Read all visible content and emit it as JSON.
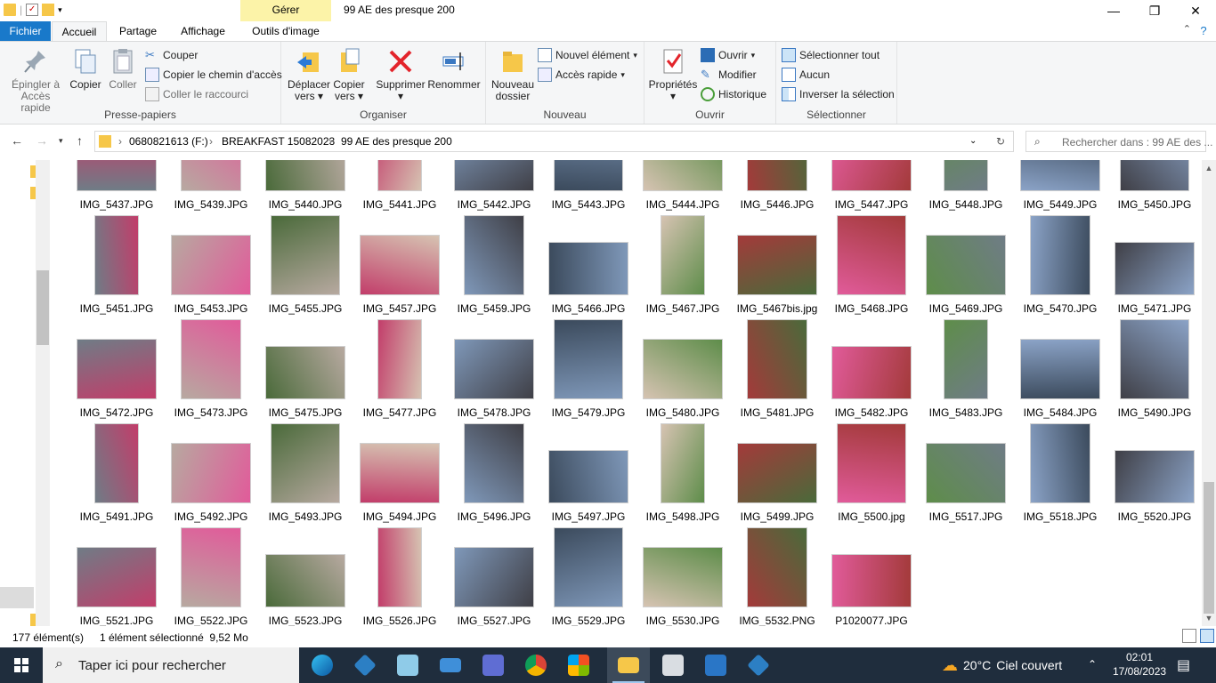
{
  "window": {
    "title": "99 AE des presque 200",
    "manage_tab": "Gérer",
    "min": "—",
    "max": "❐",
    "close": "✕"
  },
  "tabs": {
    "file": "Fichier",
    "home": "Accueil",
    "share": "Partage",
    "view": "Affichage",
    "picture_tools": "Outils d'image"
  },
  "ribbon": {
    "clipboard": {
      "label": "Presse-papiers",
      "pin": "Épingler à",
      "pin2": "Accès rapide",
      "copy": "Copier",
      "paste": "Coller",
      "cut": "Couper",
      "copy_path": "Copier le chemin d'accès",
      "paste_shortcut": "Coller le raccourci"
    },
    "organize": {
      "label": "Organiser",
      "move1": "Déplacer",
      "move2": "vers",
      "copyto1": "Copier",
      "copyto2": "vers",
      "delete1": "Supprimer",
      "rename": "Renommer"
    },
    "new": {
      "label": "Nouveau",
      "new_folder1": "Nouveau",
      "new_folder2": "dossier",
      "new_item": "Nouvel élément",
      "easy_access": "Accès rapide"
    },
    "open": {
      "label": "Ouvrir",
      "properties": "Propriétés",
      "open": "Ouvrir",
      "edit": "Modifier",
      "history": "Historique"
    },
    "select": {
      "label": "Sélectionner",
      "select_all": "Sélectionner tout",
      "none": "Aucun",
      "invert": "Inverser la sélection"
    }
  },
  "address": {
    "drive": "0680821613 (F:)",
    "folder1": "BREAKFAST 15082023",
    "folder2": "99 AE des presque 200",
    "search_placeholder": "Rechercher dans : 99 AE des ..."
  },
  "files": [
    [
      "IMG_5437.JPG",
      "IMG_5439.JPG",
      "IMG_5440.JPG",
      "IMG_5441.JPG",
      "IMG_5442.JPG",
      "IMG_5443.JPG",
      "IMG_5444.JPG",
      "IMG_5446.JPG",
      "IMG_5447.JPG",
      "IMG_5448.JPG",
      "IMG_5449.JPG",
      "IMG_5450.JPG"
    ],
    [
      "IMG_5451.JPG",
      "IMG_5453.JPG",
      "IMG_5455.JPG",
      "IMG_5457.JPG",
      "IMG_5459.JPG",
      "IMG_5466.JPG",
      "IMG_5467.JPG",
      "IMG_5467bis.jpg",
      "IMG_5468.JPG",
      "IMG_5469.JPG",
      "IMG_5470.JPG",
      "IMG_5471.JPG"
    ],
    [
      "IMG_5472.JPG",
      "IMG_5473.JPG",
      "IMG_5475.JPG",
      "IMG_5477.JPG",
      "IMG_5478.JPG",
      "IMG_5479.JPG",
      "IMG_5480.JPG",
      "IMG_5481.JPG",
      "IMG_5482.JPG",
      "IMG_5483.JPG",
      "IMG_5484.JPG",
      "IMG_5490.JPG"
    ],
    [
      "IMG_5491.JPG",
      "IMG_5492.JPG",
      "IMG_5493.JPG",
      "IMG_5494.JPG",
      "IMG_5496.JPG",
      "IMG_5497.JPG",
      "IMG_5498.JPG",
      "IMG_5499.JPG",
      "IMG_5500.jpg",
      "IMG_5517.JPG",
      "IMG_5518.JPG",
      "IMG_5520.JPG"
    ],
    [
      "IMG_5521.JPG",
      "IMG_5522.JPG",
      "IMG_5523.JPG",
      "IMG_5526.JPG",
      "IMG_5527.JPG",
      "IMG_5529.JPG",
      "IMG_5530.JPG",
      "IMG_5532.PNG",
      "P1020077.JPG"
    ]
  ],
  "status": {
    "count": "177 élément(s)",
    "selection": "1 élément sélectionné  9,52 Mo"
  },
  "taskbar": {
    "search": "Taper ici pour rechercher",
    "temp": "20°C",
    "weather": "Ciel couvert",
    "time": "02:01",
    "date": "17/08/2023"
  }
}
